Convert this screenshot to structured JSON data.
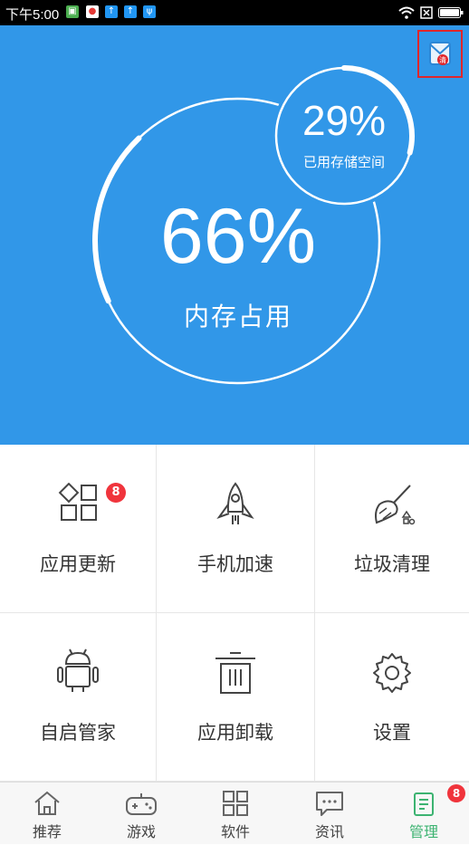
{
  "status_bar": {
    "time": "下午5:00"
  },
  "hero": {
    "memory_percent": "66%",
    "memory_label": "内存占用",
    "memory_fraction": 0.66,
    "storage_percent": "29%",
    "storage_label": "已用存储空间",
    "storage_fraction": 0.29,
    "bg_color": "#3197e8"
  },
  "grid": [
    {
      "label": "应用更新",
      "icon": "app-update-icon",
      "badge": "8"
    },
    {
      "label": "手机加速",
      "icon": "rocket-icon"
    },
    {
      "label": "垃圾清理",
      "icon": "broom-icon"
    },
    {
      "label": "自启管家",
      "icon": "android-icon"
    },
    {
      "label": "应用卸载",
      "icon": "trash-icon"
    },
    {
      "label": "设置",
      "icon": "gear-icon"
    }
  ],
  "tabs": [
    {
      "label": "推荐",
      "icon": "home-icon"
    },
    {
      "label": "游戏",
      "icon": "gamepad-icon"
    },
    {
      "label": "软件",
      "icon": "apps-icon"
    },
    {
      "label": "资讯",
      "icon": "message-icon"
    },
    {
      "label": "管理",
      "icon": "manage-icon",
      "badge": "8",
      "active": true
    }
  ],
  "colors": {
    "accent": "#3197e8",
    "badge": "#f0343c",
    "active_tab": "#3cb371"
  }
}
